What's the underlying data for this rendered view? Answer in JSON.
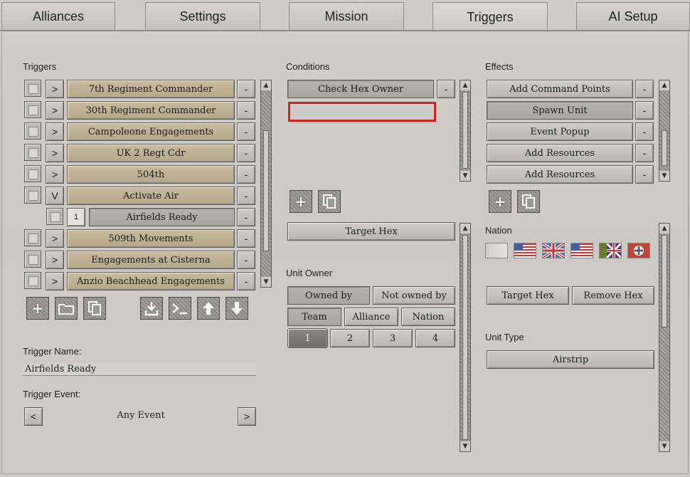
{
  "tabs": [
    "Alliances",
    "Settings",
    "Mission",
    "Triggers",
    "AI Setup"
  ],
  "active_tab": "Triggers",
  "triggers": {
    "label": "Triggers",
    "items": [
      {
        "toggle": ">",
        "label": "7th Regiment Commander"
      },
      {
        "toggle": ">",
        "label": "30th Regiment Commander"
      },
      {
        "toggle": ">",
        "label": "Campoleone Engagements"
      },
      {
        "toggle": ">",
        "label": "UK 2 Regt Cdr"
      },
      {
        "toggle": ">",
        "label": "504th"
      },
      {
        "toggle": "V",
        "label": "Activate Air"
      },
      {
        "toggle": "1",
        "label": "Airfields Ready",
        "child": true
      },
      {
        "toggle": ">",
        "label": "509th Movements"
      },
      {
        "toggle": ">",
        "label": "Engagements at Cisterna"
      },
      {
        "toggle": ">",
        "label": "Anzio Beachhead Engagements"
      }
    ],
    "remove_label": "-",
    "trigger_name_label": "Trigger Name:",
    "trigger_name_value": "Airfields Ready",
    "trigger_event_label": "Trigger Event:",
    "trigger_event_value": "Any Event",
    "prev": "<",
    "next": ">"
  },
  "conditions": {
    "label": "Conditions",
    "items": [
      "Check Hex Owner"
    ],
    "target_hex": "Target Hex",
    "unit_owner_label": "Unit Owner",
    "owned_by": "Owned by",
    "not_owned_by": "Not owned by",
    "team": "Team",
    "alliance": "Alliance",
    "nation": "Nation",
    "numbers": [
      "1",
      "2",
      "3",
      "4"
    ]
  },
  "effects": {
    "label": "Effects",
    "items": [
      "Add Command Points",
      "Spawn Unit",
      "Event Popup",
      "Add Resources",
      "Add Resources"
    ],
    "nation_label": "Nation",
    "target_hex": "Target Hex",
    "remove_hex": "Remove Hex",
    "unit_type_label": "Unit Type",
    "unit_type_value": "Airstrip"
  },
  "icons": {
    "add": "+",
    "minus": "-",
    "scroll_up": "▲",
    "scroll_down": "▼"
  }
}
